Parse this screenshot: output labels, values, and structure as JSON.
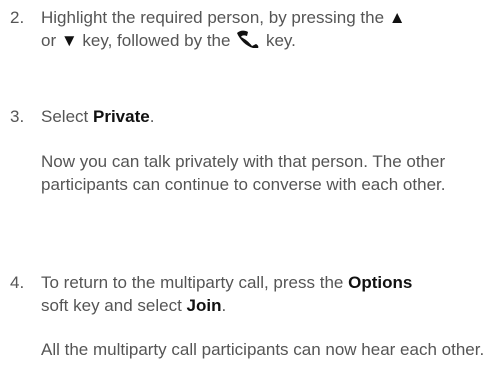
{
  "steps": [
    {
      "number": "2.",
      "parts": {
        "a": "Highlight the required person, by pressing the",
        "b": "or",
        "c": "key, followed by the",
        "d": "key."
      },
      "icons": {
        "up": "▲",
        "down": "▼",
        "call": "call-key-icon"
      }
    },
    {
      "number": "3.",
      "parts": {
        "a": "Select",
        "bold": "Private",
        "end": "."
      },
      "note": "Now you can talk privately with that person. The other participants can continue to converse with each other."
    },
    {
      "number": "4.",
      "parts": {
        "a": "To return to the multiparty call, press the",
        "bold1": "Options",
        "b": "soft key and select",
        "bold2": "Join",
        "end": "."
      },
      "note": "All the multiparty call participants can now hear each other."
    }
  ],
  "colors": {
    "text": "#555555",
    "emphasis": "#111111"
  }
}
